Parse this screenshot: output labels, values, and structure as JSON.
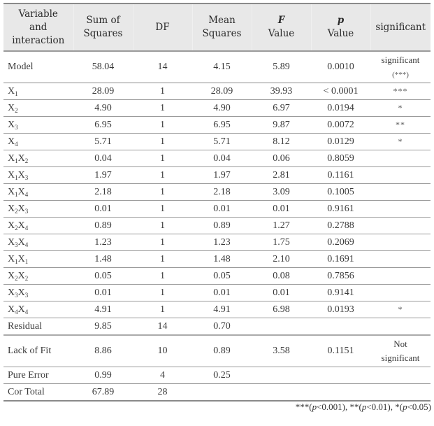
{
  "table": {
    "headers": {
      "variable": [
        "Variable",
        "and",
        "interaction"
      ],
      "sum_of_squares": [
        "Sum of",
        "Squares"
      ],
      "df": "DF",
      "mean_squares": [
        "Mean",
        "Squares"
      ],
      "f_value": [
        "F",
        "Value"
      ],
      "p_value": [
        "p",
        "Value"
      ],
      "significant": "significant"
    },
    "rows": [
      {
        "term": "Model",
        "term_base": [],
        "ss": "58.04",
        "df": "14",
        "ms": "4.15",
        "f": "5.89",
        "p": "0.0010",
        "sig": [
          "significant",
          "(***)"
        ]
      },
      {
        "term": "X1",
        "term_base": [
          [
            "X",
            "1"
          ]
        ],
        "ss": "28.09",
        "df": "1",
        "ms": "28.09",
        "f": "39.93",
        "p": "< 0.0001",
        "sig": [
          "***"
        ]
      },
      {
        "term": "X2",
        "term_base": [
          [
            "X",
            "2"
          ]
        ],
        "ss": "4.90",
        "df": "1",
        "ms": "4.90",
        "f": "6.97",
        "p": "0.0194",
        "sig": [
          "*"
        ]
      },
      {
        "term": "X3",
        "term_base": [
          [
            "X",
            "3"
          ]
        ],
        "ss": "6.95",
        "df": "1",
        "ms": "6.95",
        "f": "9.87",
        "p": "0.0072",
        "sig": [
          "**"
        ]
      },
      {
        "term": "X4",
        "term_base": [
          [
            "X",
            "4"
          ]
        ],
        "ss": "5.71",
        "df": "1",
        "ms": "5.71",
        "f": "8.12",
        "p": "0.0129",
        "sig": [
          "*"
        ]
      },
      {
        "term": "X1X2",
        "term_base": [
          [
            "X",
            "1"
          ],
          [
            "X",
            "2"
          ]
        ],
        "ss": "0.04",
        "df": "1",
        "ms": "0.04",
        "f": "0.06",
        "p": "0.8059",
        "sig": []
      },
      {
        "term": "X1X3",
        "term_base": [
          [
            "X",
            "1"
          ],
          [
            "X",
            "3"
          ]
        ],
        "ss": "1.97",
        "df": "1",
        "ms": "1.97",
        "f": "2.81",
        "p": "0.1161",
        "sig": []
      },
      {
        "term": "X1X4",
        "term_base": [
          [
            "X",
            "1"
          ],
          [
            "X",
            "4"
          ]
        ],
        "ss": "2.18",
        "df": "1",
        "ms": "2.18",
        "f": "3.09",
        "p": "0.1005",
        "sig": []
      },
      {
        "term": "X2X3",
        "term_base": [
          [
            "X",
            "2"
          ],
          [
            "X",
            "3"
          ]
        ],
        "ss": "0.01",
        "df": "1",
        "ms": "0.01",
        "f": "0.01",
        "p": "0.9161",
        "sig": []
      },
      {
        "term": "X2X4",
        "term_base": [
          [
            "X",
            "2"
          ],
          [
            "X",
            "4"
          ]
        ],
        "ss": "0.89",
        "df": "1",
        "ms": "0.89",
        "f": "1.27",
        "p": "0.2788",
        "sig": []
      },
      {
        "term": "X3X4",
        "term_base": [
          [
            "X",
            "3"
          ],
          [
            "X",
            "4"
          ]
        ],
        "ss": "1.23",
        "df": "1",
        "ms": "1.23",
        "f": "1.75",
        "p": "0.2069",
        "sig": []
      },
      {
        "term": "X1X1",
        "term_base": [
          [
            "X",
            "1"
          ],
          [
            "X",
            "1"
          ]
        ],
        "ss": "1.48",
        "df": "1",
        "ms": "1.48",
        "f": "2.10",
        "p": "0.1691",
        "sig": []
      },
      {
        "term": "X2X2",
        "term_base": [
          [
            "X",
            "2"
          ],
          [
            "X",
            "2"
          ]
        ],
        "ss": "0.05",
        "df": "1",
        "ms": "0.05",
        "f": "0.08",
        "p": "0.7856",
        "sig": []
      },
      {
        "term": "X3X3",
        "term_base": [
          [
            "X",
            "3"
          ],
          [
            "X",
            "3"
          ]
        ],
        "ss": "0.01",
        "df": "1",
        "ms": "0.01",
        "f": "0.01",
        "p": "0.9141",
        "sig": []
      },
      {
        "term": "X4X4",
        "term_base": [
          [
            "X",
            "4"
          ],
          [
            "X",
            "4"
          ]
        ],
        "ss": "4.91",
        "df": "1",
        "ms": "4.91",
        "f": "6.98",
        "p": "0.0193",
        "sig": [
          "*"
        ]
      },
      {
        "term": "Residual",
        "term_base": [],
        "ss": "9.85",
        "df": "14",
        "ms": "0.70",
        "f": "",
        "p": "",
        "sig": []
      },
      {
        "term": "Lack of Fit",
        "term_base": [],
        "ss": "8.86",
        "df": "10",
        "ms": "0.89",
        "f": "3.58",
        "p": "0.1151",
        "sig": [
          "Not",
          "significant"
        ]
      },
      {
        "term": "Pure Error",
        "term_base": [],
        "ss": "0.99",
        "df": "4",
        "ms": "0.25",
        "f": "",
        "p": "",
        "sig": []
      },
      {
        "term": "Cor Total",
        "term_base": [],
        "ss": "67.89",
        "df": "28",
        "ms": "",
        "f": "",
        "p": "",
        "sig": []
      }
    ]
  },
  "footnote": {
    "parts": [
      {
        "text": "***(",
        "italic": false
      },
      {
        "text": "p",
        "italic": true
      },
      {
        "text": "<0.001),  **(",
        "italic": false
      },
      {
        "text": "p",
        "italic": true
      },
      {
        "text": "<0.01),  *(",
        "italic": false
      },
      {
        "text": "p",
        "italic": true
      },
      {
        "text": "<0.05)",
        "italic": false
      }
    ]
  }
}
